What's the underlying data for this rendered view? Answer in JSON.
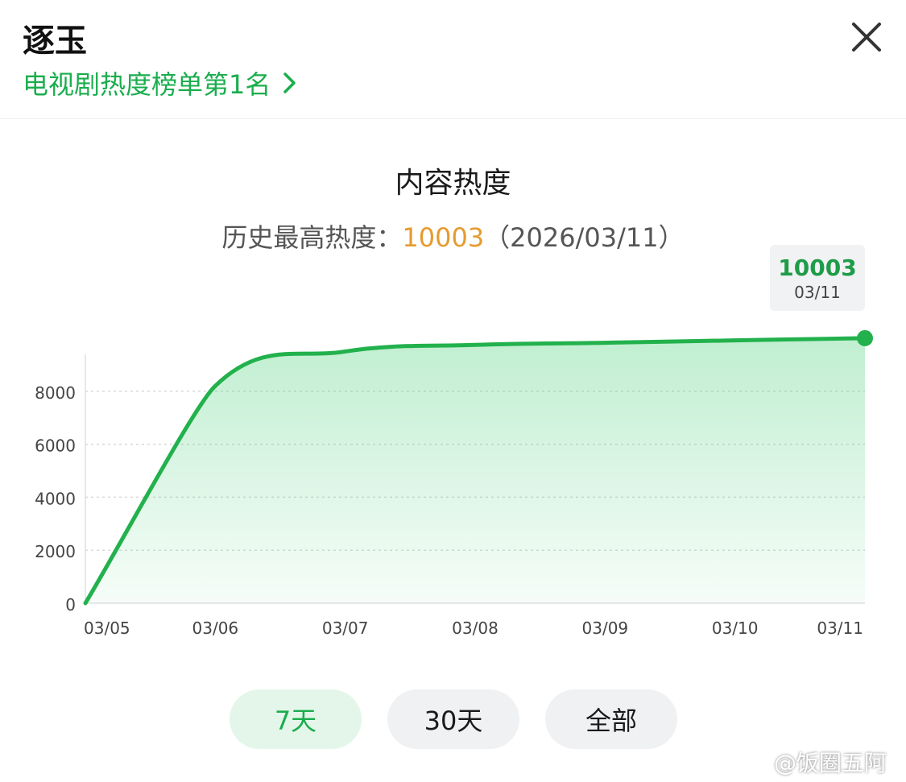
{
  "header": {
    "title": "逐玉",
    "rank_link": "电视剧热度榜单第1名"
  },
  "summary": {
    "chart_title": "内容热度",
    "max_label": "历史最高热度：",
    "max_value": "10003",
    "max_date": "（2026/03/11）"
  },
  "tooltip": {
    "value": "10003",
    "date": "03/11"
  },
  "range_tabs": [
    {
      "label": "7天",
      "active": true
    },
    {
      "label": "30天",
      "active": false
    },
    {
      "label": "全部",
      "active": false
    }
  ],
  "watermark": "@饭圈五阿哥",
  "colors": {
    "accent": "#1aad4d",
    "line": "#22b14c",
    "highlight": "#e79a2f"
  },
  "chart_data": {
    "type": "area",
    "x": [
      "03/05",
      "03/06",
      "03/07",
      "03/08",
      "03/09",
      "03/10",
      "03/11"
    ],
    "values": [
      0,
      8200,
      9500,
      9750,
      9830,
      9920,
      10003
    ],
    "y_ticks": [
      0,
      2000,
      4000,
      6000,
      8000
    ],
    "ylim": [
      0,
      10000
    ],
    "grid": true,
    "highlight_point": {
      "x": "03/11",
      "y": 10003
    }
  }
}
